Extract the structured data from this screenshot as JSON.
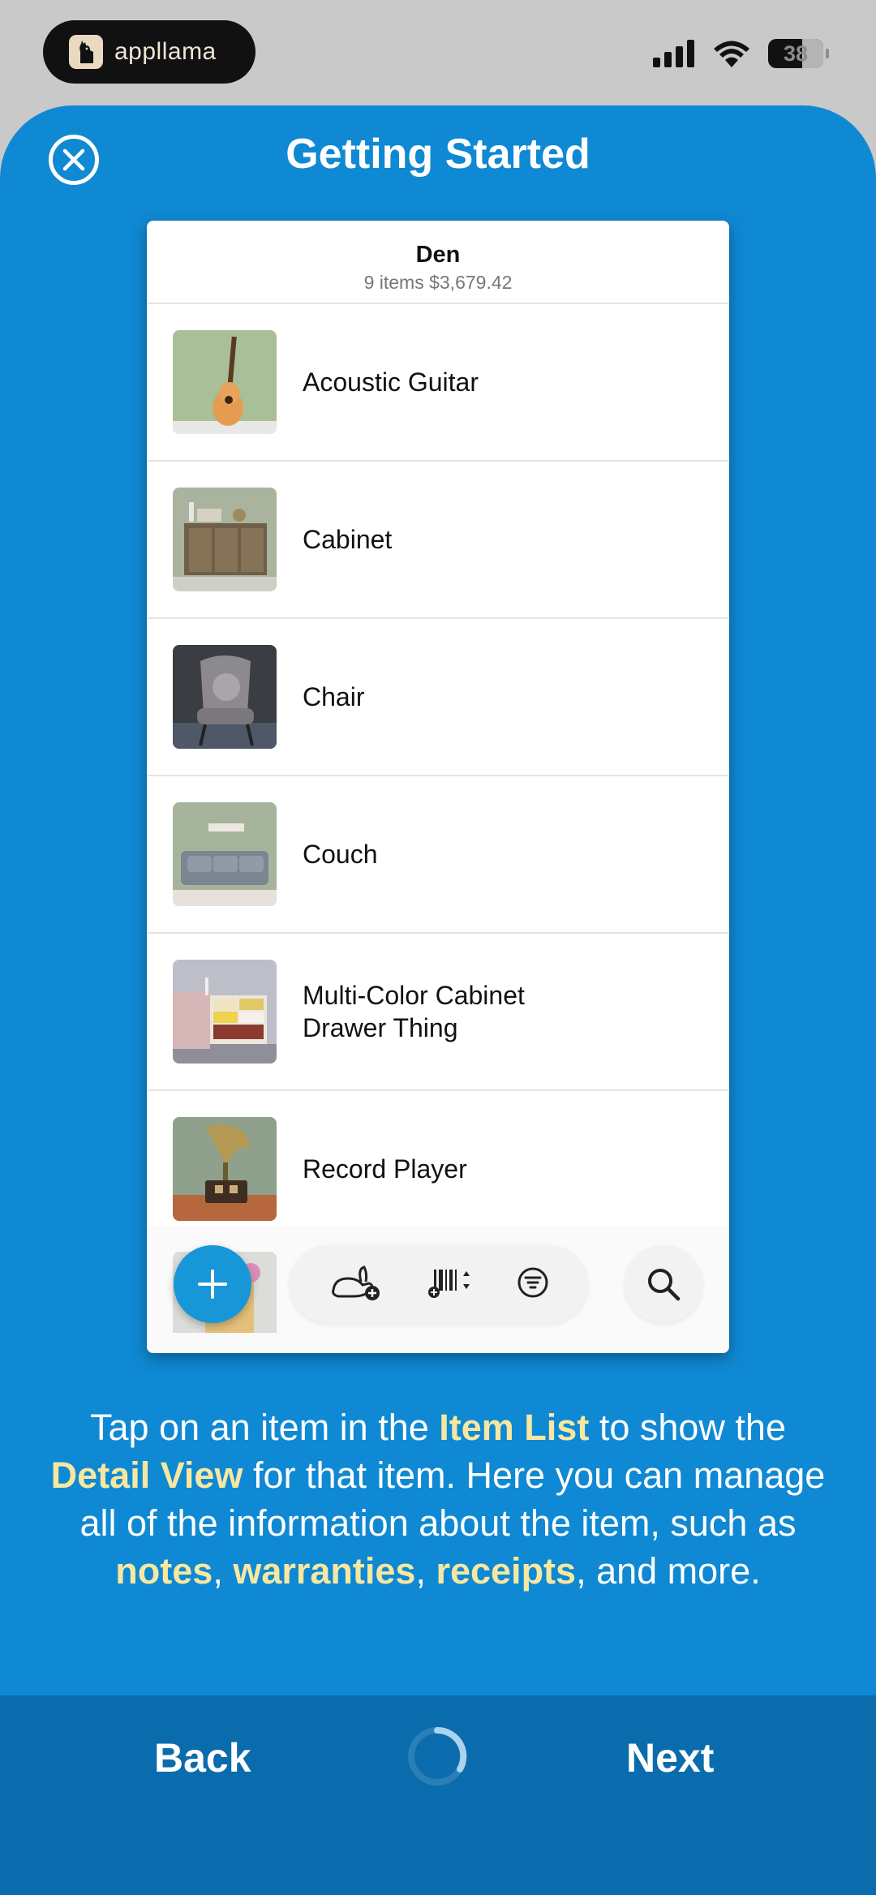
{
  "status_bar": {
    "app_name": "appllama",
    "battery": "38",
    "icons": [
      "signal-icon",
      "wifi-icon",
      "battery-icon"
    ]
  },
  "sheet": {
    "title": "Getting Started",
    "close_icon": "close-icon"
  },
  "card": {
    "title": "Den",
    "subtitle": "9 items $3,679.42",
    "items": [
      {
        "name": "Acoustic Guitar"
      },
      {
        "name": "Cabinet"
      },
      {
        "name": "Chair"
      },
      {
        "name": "Couch"
      },
      {
        "name": "Multi-Color Cabinet Drawer Thing"
      },
      {
        "name": "Record Player"
      }
    ],
    "toolbar": {
      "add_icon": "plus-icon",
      "tools": [
        "rabbit-add-icon",
        "barcode-sort-icon",
        "filter-icon"
      ],
      "search_icon": "search-icon"
    }
  },
  "help": {
    "t1": "Tap on an item in the ",
    "h1": "Item List",
    "t2": " to show the ",
    "h2": "Detail View",
    "t3": " for that item. Here you can manage all of the information about the item, such as ",
    "h3": "notes",
    "t4": ", ",
    "h4": "warranties",
    "t5": ", ",
    "h5": "receipts",
    "t6": ", and more."
  },
  "nav": {
    "back_label": "Back",
    "next_label": "Next",
    "progress_icon": "progress-spinner-icon"
  },
  "colors": {
    "sheet_bg": "#0f89d3",
    "bottom_bar_bg": "#0a6cad",
    "highlight": "#f7e7a0",
    "fab": "#1897d8"
  }
}
